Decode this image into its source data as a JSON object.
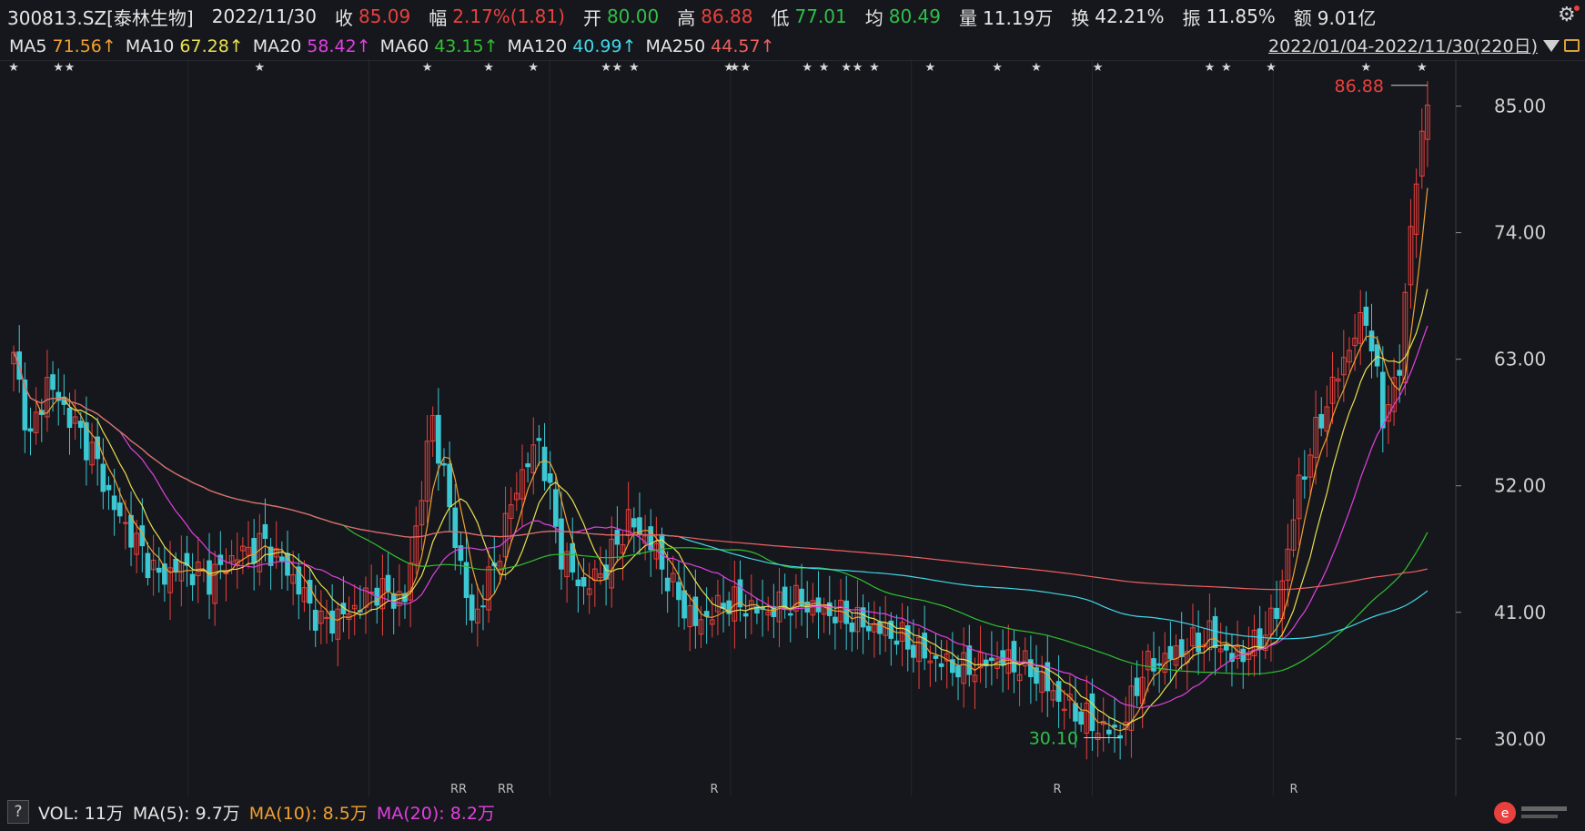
{
  "header": {
    "code": "300813.SZ[泰林生物]",
    "date": "2022/11/30",
    "close_label": "收",
    "close": "85.09",
    "change_label": "幅",
    "change": "2.17%(1.81)",
    "open_label": "开",
    "open": "80.00",
    "high_label": "高",
    "high": "86.88",
    "low_label": "低",
    "low": "77.01",
    "avg_label": "均",
    "avg": "80.49",
    "vol_label": "量",
    "vol": "11.19万",
    "turn_label": "换",
    "turn": "42.21%",
    "amp_label": "振",
    "amp": "11.85%",
    "amt_label": "额",
    "amt": "9.01亿"
  },
  "ma_bar": {
    "items": [
      {
        "name": "MA5",
        "value": "71.56↑",
        "color": "#f0a030"
      },
      {
        "name": "MA10",
        "value": "67.28↑",
        "color": "#e8e050"
      },
      {
        "name": "MA20",
        "value": "58.42↑",
        "color": "#e040e0"
      },
      {
        "name": "MA60",
        "value": "43.15↑",
        "color": "#30c030"
      },
      {
        "name": "MA120",
        "value": "40.99↑",
        "color": "#40d8e8"
      },
      {
        "name": "MA250",
        "value": "44.57↑",
        "color": "#f06060"
      }
    ],
    "range": "2022/01/04-2022/11/30(220日)"
  },
  "vol_bar": {
    "q": "?",
    "vol": "VOL: 11万",
    "ma5": "MA(5): 9.7万",
    "ma10": "MA(10): 8.5万",
    "ma20": "MA(20): 8.2万"
  },
  "chart_data": {
    "type": "candlestick",
    "ylim": [
      25,
      89
    ],
    "y_ticks": [
      "85.00",
      "74.00",
      "63.00",
      "52.00",
      "41.00",
      "30.00"
    ],
    "y_values": [
      85,
      74,
      63,
      52,
      41,
      30
    ],
    "annotations": {
      "high": "86.88",
      "low": "30.10"
    },
    "bottom_marks": [
      "RR",
      "RR",
      "R",
      "R",
      "R"
    ],
    "colors": {
      "up": "#e8413d",
      "down": "#3cc8d2"
    },
    "close_keypoints": [
      [
        0,
        63
      ],
      [
        3,
        56
      ],
      [
        6,
        61
      ],
      [
        10,
        58
      ],
      [
        14,
        55
      ],
      [
        18,
        50
      ],
      [
        22,
        47
      ],
      [
        26,
        44
      ],
      [
        30,
        45
      ],
      [
        35,
        44
      ],
      [
        40,
        46
      ],
      [
        45,
        47
      ],
      [
        50,
        44
      ],
      [
        55,
        40
      ],
      [
        60,
        41
      ],
      [
        65,
        43
      ],
      [
        70,
        42
      ],
      [
        75,
        58
      ],
      [
        78,
        50
      ],
      [
        82,
        40
      ],
      [
        86,
        45
      ],
      [
        90,
        52
      ],
      [
        94,
        56
      ],
      [
        98,
        46
      ],
      [
        102,
        43
      ],
      [
        106,
        45
      ],
      [
        110,
        49
      ],
      [
        114,
        47
      ],
      [
        118,
        43
      ],
      [
        122,
        40
      ],
      [
        128,
        42
      ],
      [
        134,
        41
      ],
      [
        140,
        42
      ],
      [
        146,
        41
      ],
      [
        152,
        40
      ],
      [
        158,
        39
      ],
      [
        164,
        37
      ],
      [
        170,
        36
      ],
      [
        176,
        37
      ],
      [
        182,
        36
      ],
      [
        188,
        33
      ],
      [
        194,
        31
      ],
      [
        198,
        30.5
      ],
      [
        202,
        36
      ],
      [
        206,
        37
      ],
      [
        210,
        38
      ],
      [
        214,
        39
      ],
      [
        218,
        37
      ],
      [
        222,
        38
      ],
      [
        226,
        41
      ],
      [
        230,
        52
      ],
      [
        234,
        58
      ],
      [
        238,
        63
      ],
      [
        242,
        67
      ],
      [
        245,
        58
      ],
      [
        248,
        62
      ],
      [
        250,
        75
      ],
      [
        253,
        85
      ]
    ],
    "ma_colors": {
      "ma5": "#f0a030",
      "ma10": "#e8e050",
      "ma20": "#e040e0",
      "ma60": "#30c030",
      "ma120": "#40d8e8",
      "ma250": "#f06060"
    }
  }
}
